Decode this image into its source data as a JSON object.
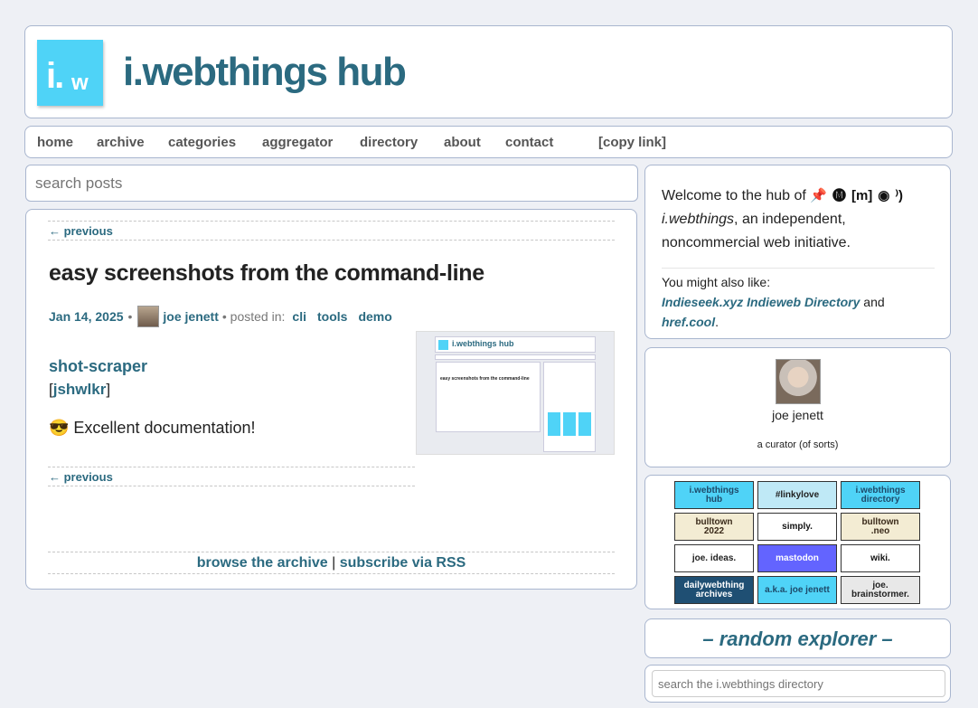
{
  "header": {
    "logo_main": "i.",
    "logo_sub": "w",
    "site_title": "i.webthings hub"
  },
  "nav": {
    "items": [
      "home",
      "archive",
      "categories",
      "aggregator",
      "directory",
      "about",
      "contact",
      "[copy link]"
    ]
  },
  "search": {
    "placeholder": "search posts"
  },
  "post": {
    "prev_top": "← previous",
    "title": "easy screenshots from the command-line",
    "date": "Jan 14, 2025",
    "bullet": "•",
    "author": "joe jenett",
    "posted_in": "• posted in:",
    "tags": [
      "cli",
      "tools",
      "demo"
    ],
    "shot_title": "shot-scraper",
    "repo_open": "[",
    "repo_label": "jshwlkr",
    "repo_close": "]",
    "description": "😎 Excellent documentation!",
    "prev_bottom": "← previous",
    "thumb_title": "i.webthings hub",
    "thumb_post": "easy screenshots from the command-line"
  },
  "footer_links": {
    "archive": "browse the archive",
    "sep": " | ",
    "rss": "subscribe via RSS"
  },
  "welcome": {
    "text_before": "Welcome to the hub of ",
    "icons": {
      "pin": "📌",
      "mastodon": "🅜",
      "matrix": "[m]",
      "github": "◉",
      "rss": "⁾)"
    },
    "brand": "i.webthings",
    "text_after": ", an independent, noncommercial web initiative.",
    "also_label": "You might also like:",
    "link1": "Indieseek.xyz Indieweb Directory",
    "and": " and ",
    "link2": "href.cool",
    "dot": "."
  },
  "curator": {
    "name": "joe jenett",
    "role": "a curator (of sorts)"
  },
  "badges": [
    {
      "label": "i.webthings\nhub",
      "bg": "#4fd3f7",
      "fg": "#1d4a6a"
    },
    {
      "label": "#linkylove",
      "bg": "#bfe9f6",
      "fg": "#222"
    },
    {
      "label": "i.webthings\ndirectory",
      "bg": "#4fd3f7",
      "fg": "#1d4a6a"
    },
    {
      "label": "bulltown\n2022",
      "bg": "#f3ecd3",
      "fg": "#3a2a1a"
    },
    {
      "label": "simply.",
      "bg": "#fff",
      "fg": "#111"
    },
    {
      "label": "bulltown\n.neo",
      "bg": "#f3ecd3",
      "fg": "#3a2a1a"
    },
    {
      "label": "joe. ideas.",
      "bg": "#fff",
      "fg": "#222"
    },
    {
      "label": "mastodon",
      "bg": "#6364ff",
      "fg": "#fff"
    },
    {
      "label": "wiki.",
      "bg": "#fff",
      "fg": "#111"
    },
    {
      "label": "dailywebthing\narchives",
      "bg": "#1f4f73",
      "fg": "#fff"
    },
    {
      "label": "a.k.a. joe jenett",
      "bg": "#4fd3f7",
      "fg": "#1d4a6a"
    },
    {
      "label": "joe.\nbrainstormer.",
      "bg": "#e8e8e8",
      "fg": "#222"
    }
  ],
  "random_explorer": "– random explorer –",
  "directory_search": {
    "placeholder": "search the i.webthings directory"
  }
}
